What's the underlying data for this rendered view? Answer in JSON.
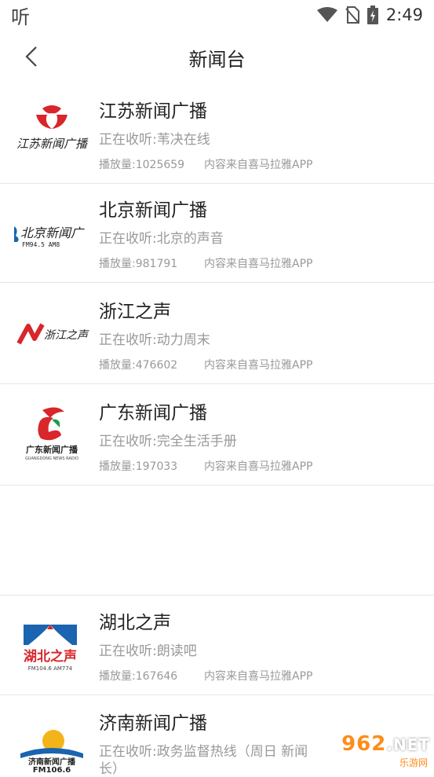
{
  "status_bar": {
    "left_char": "听",
    "time": "2:49",
    "icons": [
      "wifi-icon",
      "no-sim-icon",
      "battery-charging-icon"
    ]
  },
  "header": {
    "title": "新闻台",
    "back_icon": "chevron-left-icon"
  },
  "stations": [
    {
      "name": "江苏新闻广播",
      "listening": "正在收听:苇决在线",
      "plays": "播放量:1025659",
      "source": "内容来自喜马拉雅APP",
      "logo_text": "江苏新闻广播"
    },
    {
      "name": "北京新闻广播",
      "listening": "正在收听:北京的声音",
      "plays": "播放量:981791",
      "source": "内容来自喜马拉雅APP",
      "logo_text": "北京新闻广",
      "logo_sub": "FM94.5 AM8"
    },
    {
      "name": "浙江之声",
      "listening": "正在收听:动力周末",
      "plays": "播放量:476602",
      "source": "内容来自喜马拉雅APP",
      "logo_text": "浙江之声"
    },
    {
      "name": "广东新闻广播",
      "listening": "正在收听:完全生活手册",
      "plays": "播放量:197033",
      "source": "内容来自喜马拉雅APP",
      "logo_text": "广东新闻广播",
      "logo_sub": "GUANGDONG NEWS RADIO"
    },
    {
      "name": "湖北之声",
      "listening": "正在收听:朗读吧",
      "plays": "播放量:167646",
      "source": "内容来自喜马拉雅APP",
      "logo_text": "湖北之声",
      "logo_sub": "FM104.6 AM774"
    },
    {
      "name": "济南新闻广播",
      "listening": "正在收听:政务监督热线（周日 新闻",
      "listening_cont": "长）",
      "logo_text": "济南新闻广播",
      "logo_sub": "FM106.6"
    }
  ],
  "watermark": {
    "num": "962",
    "net": ".NET",
    "sub": "乐游网"
  },
  "colors": {
    "accent_red": "#d8262b",
    "blue": "#1a64b0",
    "watermark_orange": "#ff8c1a"
  }
}
